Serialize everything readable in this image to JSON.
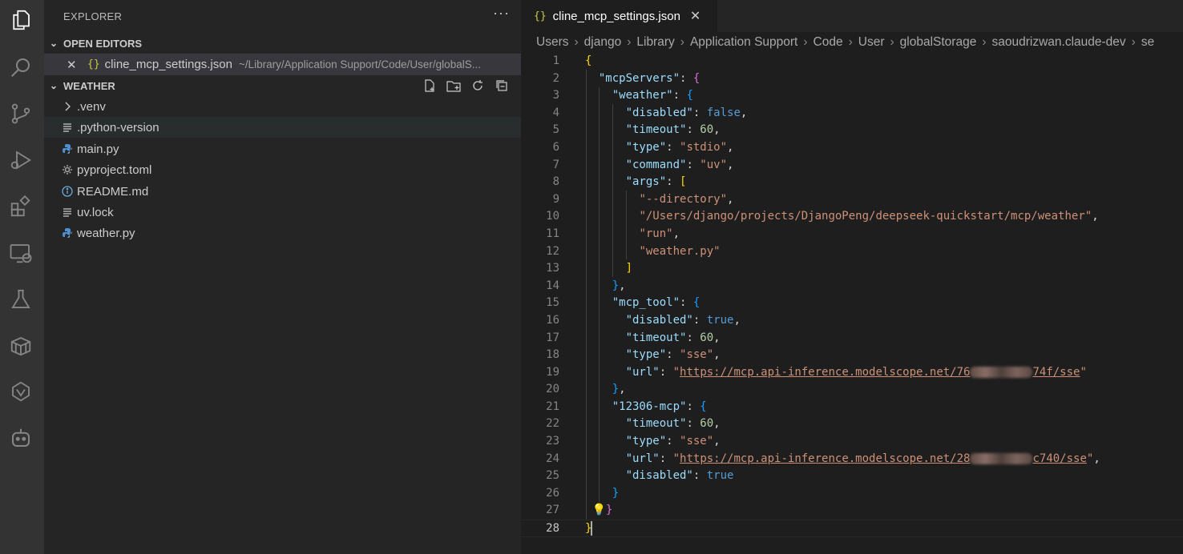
{
  "activity_bar": {
    "icons": [
      "explorer-icon",
      "search-icon",
      "source-control-icon",
      "run-debug-icon",
      "extensions-icon",
      "remote-explorer-icon",
      "testing-icon",
      "containers-icon",
      "codeium-icon",
      "copilot-icon"
    ]
  },
  "sidebar": {
    "title": "EXPLORER",
    "more": "···",
    "open_editors": {
      "heading": "OPEN EDITORS",
      "item": {
        "close": "✕",
        "braces": "{}",
        "name": "cline_mcp_settings.json",
        "path": "~/Library/Application Support/Code/User/globalS..."
      }
    },
    "workspace": {
      "heading": "WEATHER",
      "items": [
        {
          "label": ".venv",
          "icon": "chevron-right-icon"
        },
        {
          "label": ".python-version",
          "icon": "lines-file-icon"
        },
        {
          "label": "main.py",
          "icon": "python-file-icon"
        },
        {
          "label": "pyproject.toml",
          "icon": "gear-file-icon"
        },
        {
          "label": "README.md",
          "icon": "info-file-icon"
        },
        {
          "label": "uv.lock",
          "icon": "lines-file-icon"
        },
        {
          "label": "weather.py",
          "icon": "python-file-icon"
        }
      ]
    }
  },
  "editor": {
    "tab": {
      "braces": "{}",
      "label": "cline_mcp_settings.json",
      "close": "✕"
    },
    "breadcrumbs": [
      "Users",
      "django",
      "Library",
      "Application Support",
      "Code",
      "User",
      "globalStorage",
      "saoudrizwan.claude-dev",
      "se"
    ],
    "url1_prefix": "https://mcp.api-inference.modelscope.net/76",
    "url1_suffix": "74f/sse",
    "url2_prefix": "https://mcp.api-inference.modelscope.net/28",
    "url2_suffix": "c740/sse",
    "directory_path": "/Users/django/projects/DjangoPeng/deepseek-quickstart/mcp/weather",
    "line_numbers": [
      "1",
      "2",
      "3",
      "4",
      "5",
      "6",
      "7",
      "8",
      "9",
      "10",
      "11",
      "12",
      "13",
      "14",
      "15",
      "16",
      "17",
      "18",
      "19",
      "20",
      "21",
      "22",
      "23",
      "24",
      "25",
      "26",
      "27",
      "28"
    ]
  },
  "colors": {
    "accent_yellow": "#cbcb41",
    "string": "#ce9178",
    "key": "#9cdcfe",
    "boolean": "#569cd6",
    "number": "#b5cea8"
  }
}
